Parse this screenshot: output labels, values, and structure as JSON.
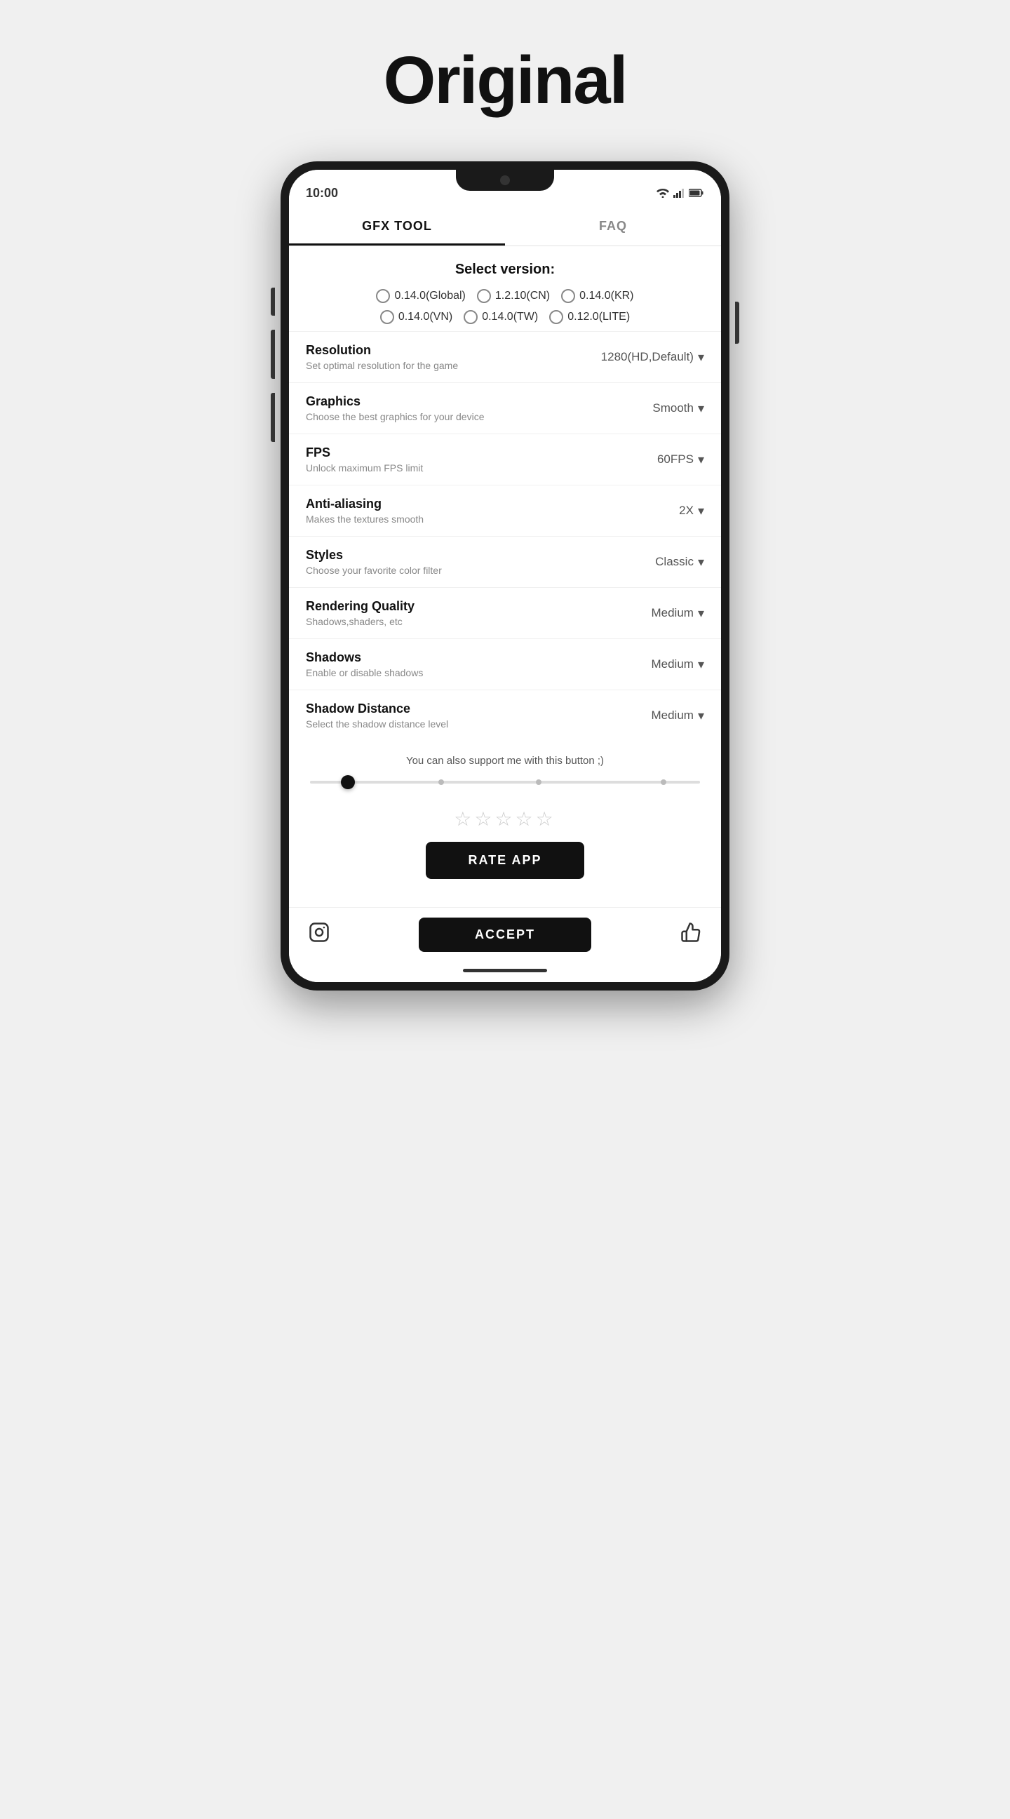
{
  "page": {
    "title": "Original"
  },
  "tabs": [
    {
      "id": "gfx",
      "label": "GFX TOOL",
      "active": true
    },
    {
      "id": "faq",
      "label": "FAQ",
      "active": false
    }
  ],
  "version_section": {
    "title": "Select version:",
    "options": [
      {
        "label": "0.14.0(Global)"
      },
      {
        "label": "1.2.10(CN)"
      },
      {
        "label": "0.14.0(KR)"
      },
      {
        "label": "0.14.0(VN)"
      },
      {
        "label": "0.14.0(TW)"
      },
      {
        "label": "0.12.0(LITE)"
      }
    ]
  },
  "settings": [
    {
      "id": "resolution",
      "label": "Resolution",
      "desc": "Set optimal resolution for the game",
      "value": "1280(HD,Default)"
    },
    {
      "id": "graphics",
      "label": "Graphics",
      "desc": "Choose the best graphics for your device",
      "value": "Smooth"
    },
    {
      "id": "fps",
      "label": "FPS",
      "desc": "Unlock maximum FPS limit",
      "value": "60FPS"
    },
    {
      "id": "anti_aliasing",
      "label": "Anti-aliasing",
      "desc": "Makes the textures smooth",
      "value": "2X"
    },
    {
      "id": "styles",
      "label": "Styles",
      "desc": "Choose your favorite color filter",
      "value": "Classic"
    },
    {
      "id": "rendering_quality",
      "label": "Rendering Quality",
      "desc": "Shadows,shaders, etc",
      "value": "Medium"
    },
    {
      "id": "shadows",
      "label": "Shadows",
      "desc": "Enable or disable shadows",
      "value": "Medium"
    },
    {
      "id": "shadow_distance",
      "label": "Shadow Distance",
      "desc": "Select the shadow distance level",
      "value": "Medium"
    }
  ],
  "support_text": "You can also support me with this button ;)",
  "stars": "☆☆☆☆☆",
  "rate_btn_label": "RATE APP",
  "bottom": {
    "accept_label": "ACCEPT"
  },
  "status": {
    "time": "10:00"
  }
}
